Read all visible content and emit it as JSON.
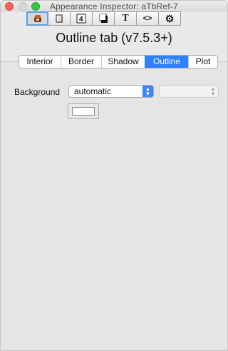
{
  "window": {
    "title": "Appearance Inspector: aTbRef-7"
  },
  "toolbar": {
    "buttons": [
      {
        "name": "appearance-icon",
        "glyph": "⛩"
      },
      {
        "name": "page-icon",
        "glyph": "▯"
      },
      {
        "name": "badge-4-icon",
        "glyph": "4"
      },
      {
        "name": "shadow-icon",
        "glyph": "▮"
      },
      {
        "name": "text-icon",
        "glyph": "T"
      },
      {
        "name": "code-icon",
        "glyph": "<>"
      },
      {
        "name": "gear-icon",
        "glyph": "⚙"
      }
    ]
  },
  "panel": {
    "title": "Outline tab (v7.5.3+)"
  },
  "tabs": [
    {
      "label": "Interior"
    },
    {
      "label": "Border"
    },
    {
      "label": "Shadow"
    },
    {
      "label": "Outline"
    },
    {
      "label": "Plot"
    }
  ],
  "fields": {
    "background_label": "Background",
    "background_value": "automatic"
  }
}
